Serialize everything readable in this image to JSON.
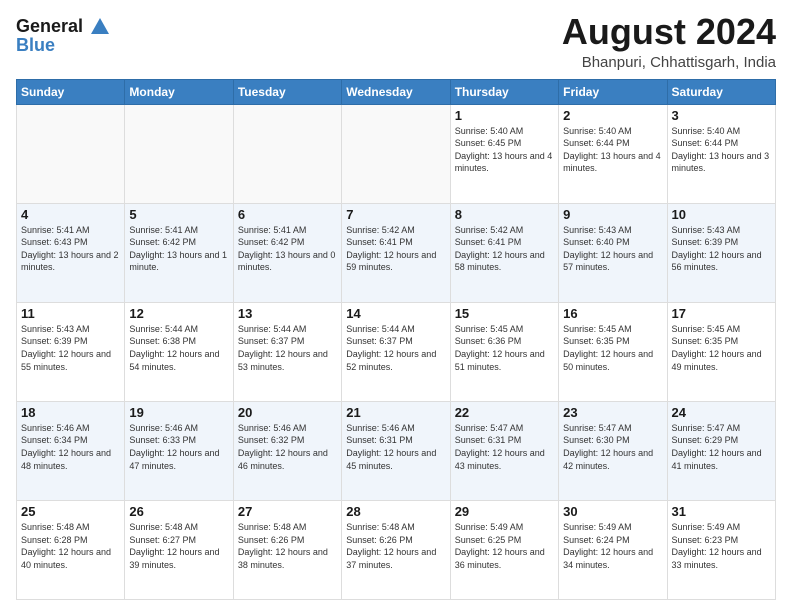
{
  "header": {
    "logo_line1": "General",
    "logo_line2": "Blue",
    "title": "August 2024",
    "subtitle": "Bhanpuri, Chhattisgarh, India"
  },
  "days_of_week": [
    "Sunday",
    "Monday",
    "Tuesday",
    "Wednesday",
    "Thursday",
    "Friday",
    "Saturday"
  ],
  "weeks": [
    [
      {
        "day": "",
        "sunrise": "",
        "sunset": "",
        "daylight": "",
        "empty": true
      },
      {
        "day": "",
        "sunrise": "",
        "sunset": "",
        "daylight": "",
        "empty": true
      },
      {
        "day": "",
        "sunrise": "",
        "sunset": "",
        "daylight": "",
        "empty": true
      },
      {
        "day": "",
        "sunrise": "",
        "sunset": "",
        "daylight": "",
        "empty": true
      },
      {
        "day": "1",
        "sunrise": "Sunrise: 5:40 AM",
        "sunset": "Sunset: 6:45 PM",
        "daylight": "Daylight: 13 hours and 4 minutes.",
        "empty": false
      },
      {
        "day": "2",
        "sunrise": "Sunrise: 5:40 AM",
        "sunset": "Sunset: 6:44 PM",
        "daylight": "Daylight: 13 hours and 4 minutes.",
        "empty": false
      },
      {
        "day": "3",
        "sunrise": "Sunrise: 5:40 AM",
        "sunset": "Sunset: 6:44 PM",
        "daylight": "Daylight: 13 hours and 3 minutes.",
        "empty": false
      }
    ],
    [
      {
        "day": "4",
        "sunrise": "Sunrise: 5:41 AM",
        "sunset": "Sunset: 6:43 PM",
        "daylight": "Daylight: 13 hours and 2 minutes.",
        "empty": false
      },
      {
        "day": "5",
        "sunrise": "Sunrise: 5:41 AM",
        "sunset": "Sunset: 6:42 PM",
        "daylight": "Daylight: 13 hours and 1 minute.",
        "empty": false
      },
      {
        "day": "6",
        "sunrise": "Sunrise: 5:41 AM",
        "sunset": "Sunset: 6:42 PM",
        "daylight": "Daylight: 13 hours and 0 minutes.",
        "empty": false
      },
      {
        "day": "7",
        "sunrise": "Sunrise: 5:42 AM",
        "sunset": "Sunset: 6:41 PM",
        "daylight": "Daylight: 12 hours and 59 minutes.",
        "empty": false
      },
      {
        "day": "8",
        "sunrise": "Sunrise: 5:42 AM",
        "sunset": "Sunset: 6:41 PM",
        "daylight": "Daylight: 12 hours and 58 minutes.",
        "empty": false
      },
      {
        "day": "9",
        "sunrise": "Sunrise: 5:43 AM",
        "sunset": "Sunset: 6:40 PM",
        "daylight": "Daylight: 12 hours and 57 minutes.",
        "empty": false
      },
      {
        "day": "10",
        "sunrise": "Sunrise: 5:43 AM",
        "sunset": "Sunset: 6:39 PM",
        "daylight": "Daylight: 12 hours and 56 minutes.",
        "empty": false
      }
    ],
    [
      {
        "day": "11",
        "sunrise": "Sunrise: 5:43 AM",
        "sunset": "Sunset: 6:39 PM",
        "daylight": "Daylight: 12 hours and 55 minutes.",
        "empty": false
      },
      {
        "day": "12",
        "sunrise": "Sunrise: 5:44 AM",
        "sunset": "Sunset: 6:38 PM",
        "daylight": "Daylight: 12 hours and 54 minutes.",
        "empty": false
      },
      {
        "day": "13",
        "sunrise": "Sunrise: 5:44 AM",
        "sunset": "Sunset: 6:37 PM",
        "daylight": "Daylight: 12 hours and 53 minutes.",
        "empty": false
      },
      {
        "day": "14",
        "sunrise": "Sunrise: 5:44 AM",
        "sunset": "Sunset: 6:37 PM",
        "daylight": "Daylight: 12 hours and 52 minutes.",
        "empty": false
      },
      {
        "day": "15",
        "sunrise": "Sunrise: 5:45 AM",
        "sunset": "Sunset: 6:36 PM",
        "daylight": "Daylight: 12 hours and 51 minutes.",
        "empty": false
      },
      {
        "day": "16",
        "sunrise": "Sunrise: 5:45 AM",
        "sunset": "Sunset: 6:35 PM",
        "daylight": "Daylight: 12 hours and 50 minutes.",
        "empty": false
      },
      {
        "day": "17",
        "sunrise": "Sunrise: 5:45 AM",
        "sunset": "Sunset: 6:35 PM",
        "daylight": "Daylight: 12 hours and 49 minutes.",
        "empty": false
      }
    ],
    [
      {
        "day": "18",
        "sunrise": "Sunrise: 5:46 AM",
        "sunset": "Sunset: 6:34 PM",
        "daylight": "Daylight: 12 hours and 48 minutes.",
        "empty": false
      },
      {
        "day": "19",
        "sunrise": "Sunrise: 5:46 AM",
        "sunset": "Sunset: 6:33 PM",
        "daylight": "Daylight: 12 hours and 47 minutes.",
        "empty": false
      },
      {
        "day": "20",
        "sunrise": "Sunrise: 5:46 AM",
        "sunset": "Sunset: 6:32 PM",
        "daylight": "Daylight: 12 hours and 46 minutes.",
        "empty": false
      },
      {
        "day": "21",
        "sunrise": "Sunrise: 5:46 AM",
        "sunset": "Sunset: 6:31 PM",
        "daylight": "Daylight: 12 hours and 45 minutes.",
        "empty": false
      },
      {
        "day": "22",
        "sunrise": "Sunrise: 5:47 AM",
        "sunset": "Sunset: 6:31 PM",
        "daylight": "Daylight: 12 hours and 43 minutes.",
        "empty": false
      },
      {
        "day": "23",
        "sunrise": "Sunrise: 5:47 AM",
        "sunset": "Sunset: 6:30 PM",
        "daylight": "Daylight: 12 hours and 42 minutes.",
        "empty": false
      },
      {
        "day": "24",
        "sunrise": "Sunrise: 5:47 AM",
        "sunset": "Sunset: 6:29 PM",
        "daylight": "Daylight: 12 hours and 41 minutes.",
        "empty": false
      }
    ],
    [
      {
        "day": "25",
        "sunrise": "Sunrise: 5:48 AM",
        "sunset": "Sunset: 6:28 PM",
        "daylight": "Daylight: 12 hours and 40 minutes.",
        "empty": false
      },
      {
        "day": "26",
        "sunrise": "Sunrise: 5:48 AM",
        "sunset": "Sunset: 6:27 PM",
        "daylight": "Daylight: 12 hours and 39 minutes.",
        "empty": false
      },
      {
        "day": "27",
        "sunrise": "Sunrise: 5:48 AM",
        "sunset": "Sunset: 6:26 PM",
        "daylight": "Daylight: 12 hours and 38 minutes.",
        "empty": false
      },
      {
        "day": "28",
        "sunrise": "Sunrise: 5:48 AM",
        "sunset": "Sunset: 6:26 PM",
        "daylight": "Daylight: 12 hours and 37 minutes.",
        "empty": false
      },
      {
        "day": "29",
        "sunrise": "Sunrise: 5:49 AM",
        "sunset": "Sunset: 6:25 PM",
        "daylight": "Daylight: 12 hours and 36 minutes.",
        "empty": false
      },
      {
        "day": "30",
        "sunrise": "Sunrise: 5:49 AM",
        "sunset": "Sunset: 6:24 PM",
        "daylight": "Daylight: 12 hours and 34 minutes.",
        "empty": false
      },
      {
        "day": "31",
        "sunrise": "Sunrise: 5:49 AM",
        "sunset": "Sunset: 6:23 PM",
        "daylight": "Daylight: 12 hours and 33 minutes.",
        "empty": false
      }
    ]
  ]
}
